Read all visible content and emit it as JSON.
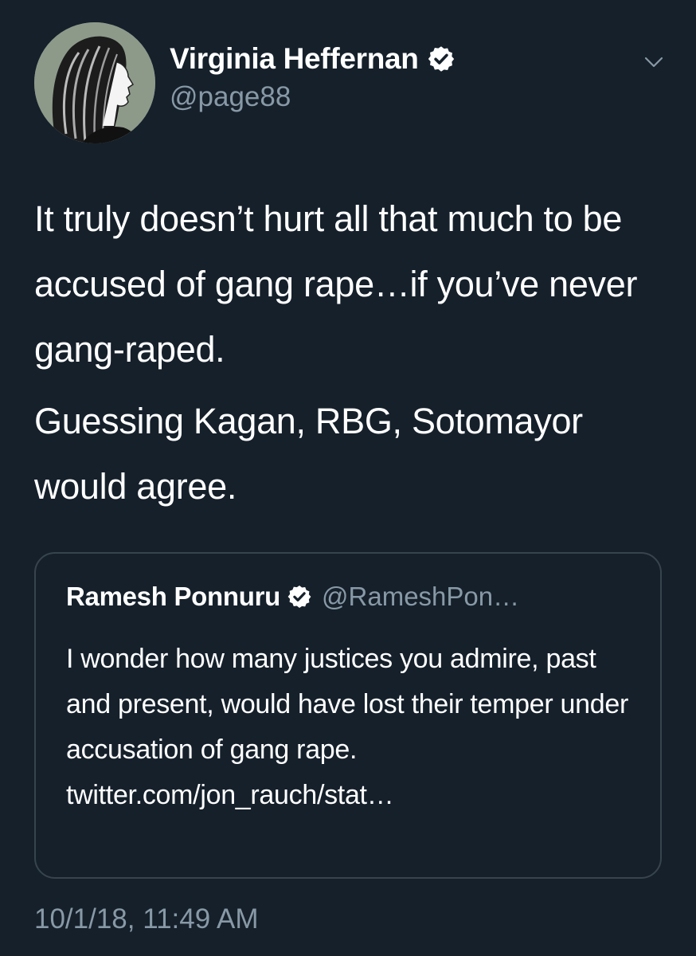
{
  "tweet": {
    "author": {
      "name": "Virginia Heffernan",
      "handle": "@page88",
      "verified": true,
      "avatar_icon": "profile-avatar"
    },
    "menu_icon": "chevron-down-icon",
    "text_paragraphs": [
      "It truly doesn’t hurt all that much to be accused of gang rape…if you’ve never gang-raped.",
      "Guessing Kagan, RBG, Sotomayor would agree."
    ],
    "timestamp": "10/1/18, 11:49 AM"
  },
  "quoted_tweet": {
    "author": {
      "name": "Ramesh Ponnuru",
      "handle": "@RameshPon…",
      "verified": true
    },
    "text": "I wonder how many justices you admire, past and present, would have lost their temper under accusation of gang rape. twitter.com/jon_rauch/stat…"
  },
  "colors": {
    "background": "#15202b",
    "text": "#ffffff",
    "secondary_text": "#8899a6",
    "border": "#38444d",
    "verified_badge": "#ffffff"
  }
}
